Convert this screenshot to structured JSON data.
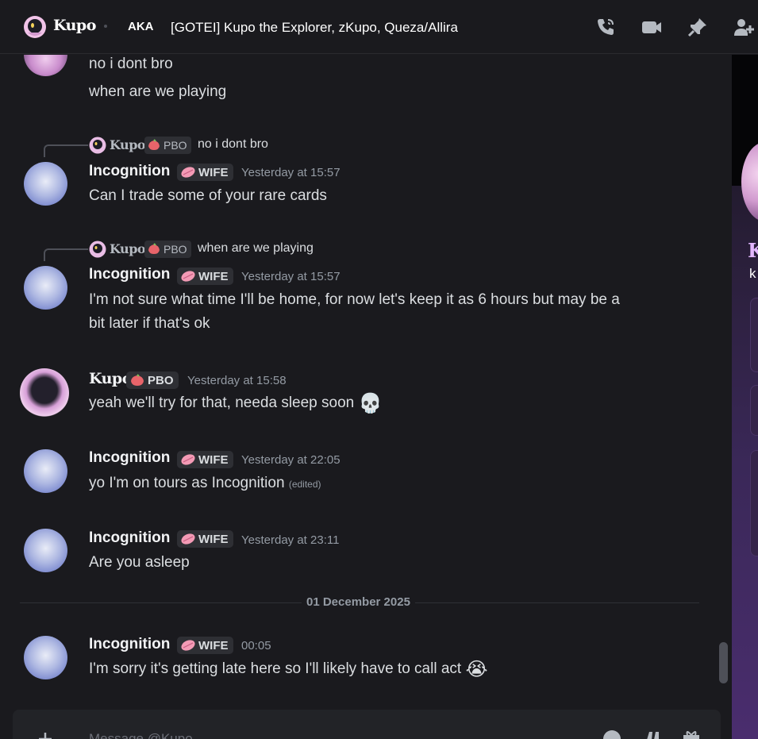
{
  "header": {
    "name": "Kupo",
    "aka_label": "AKA",
    "aliases": "[GOTEI] Kupo the Explorer, zKupo, Queza/Allira",
    "icons": [
      "phone-call-icon",
      "video-call-icon",
      "pin-icon",
      "add-friend-icon"
    ]
  },
  "messages": {
    "top": {
      "lines": [
        "no i dont bro",
        "when are we playing"
      ]
    },
    "m1": {
      "reply": {
        "name": "Kupo",
        "tag": "PBO",
        "text": "no i dont bro"
      },
      "author": "Incognition",
      "tag": "WIFE",
      "time": "Yesterday at 15:57",
      "text": "Can I trade some of your rare cards"
    },
    "m2": {
      "reply": {
        "name": "Kupo",
        "tag": "PBO",
        "text": "when are we playing"
      },
      "author": "Incognition",
      "tag": "WIFE",
      "time": "Yesterday at 15:57",
      "line1": "I'm not sure what time I'll be home, for now let's keep it as 6 hours but may be a",
      "line2": "bit later if that's ok"
    },
    "m3": {
      "author": "Kupo",
      "tag": "PBO",
      "time": "Yesterday at 15:58",
      "text": "yeah we'll try for that, needa sleep soon",
      "emoji": "💀"
    },
    "m4": {
      "author": "Incognition",
      "tag": "WIFE",
      "time": "Yesterday at 22:05",
      "text": "yo I'm on tours as Incognition",
      "edited": "(edited)"
    },
    "m5": {
      "author": "Incognition",
      "tag": "WIFE",
      "time": "Yesterday at 23:11",
      "text": "Are you asleep"
    },
    "divider": "01 December 2025",
    "m6": {
      "author": "Incognition",
      "tag": "WIFE",
      "time": "00:05",
      "text": "I'm sorry it's getting late here so I'll likely have to call act",
      "emoji": "😭"
    }
  },
  "profile_panel": {
    "name_fragment": "K",
    "sub_fragment": "k"
  },
  "composer": {
    "placeholder": "Message @Kupo"
  },
  "colors": {
    "background": "#1a1a1e",
    "text": "#dbdee1",
    "muted": "#949ba4",
    "tag_bg": "#2e2f34",
    "panel_accent": "#4a2d6e"
  }
}
